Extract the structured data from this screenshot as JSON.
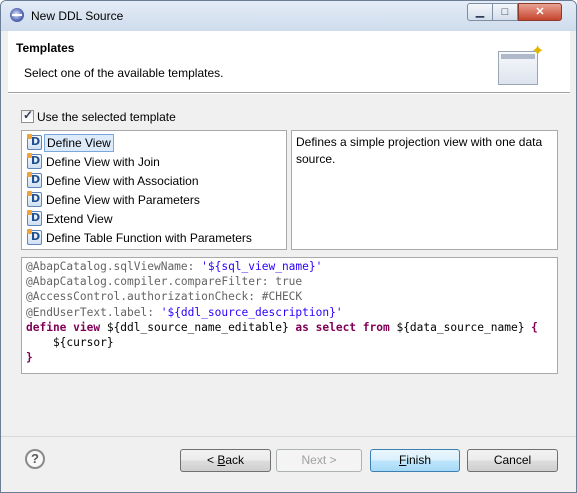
{
  "window": {
    "title": "New DDL Source",
    "controls": {
      "minimize": "▁",
      "maximize": "□",
      "close": "✕"
    }
  },
  "header": {
    "title": "Templates",
    "description": "Select one of the available templates."
  },
  "use_template": {
    "label": "Use the selected template",
    "checked": true
  },
  "templates": [
    {
      "label": "Define View",
      "selected": true
    },
    {
      "label": "Define View with Join",
      "selected": false
    },
    {
      "label": "Define View with Association",
      "selected": false
    },
    {
      "label": "Define View with Parameters",
      "selected": false
    },
    {
      "label": "Extend View",
      "selected": false
    },
    {
      "label": "Define Table Function with Parameters",
      "selected": false
    }
  ],
  "template_description": "Defines a simple projection view with one data source.",
  "code": {
    "line1_anno": "@AbapCatalog.sqlViewName: ",
    "line1_str": "'${sql_view_name}'",
    "line2_anno": "@AbapCatalog.compiler.compareFilter: true",
    "line3_anno": "@AccessControl.authorizationCheck: #CHECK",
    "line4_anno": "@EndUserText.label: ",
    "line4_str": "'${ddl_source_description}'",
    "line5_kw1": "define view",
    "line5_t1": " ${ddl_source_name_editable} ",
    "line5_kw2": "as select from",
    "line5_t2": " ${data_source_name} ",
    "line5_kw3": "{",
    "line6": "    ${cursor}",
    "line7_kw": "}"
  },
  "buttons": {
    "help": "?",
    "back_prefix": "< ",
    "back_mnemonic": "B",
    "back_rest": "ack",
    "next": "Next >",
    "finish_mnemonic": "F",
    "finish_rest": "inish",
    "cancel": "Cancel"
  }
}
